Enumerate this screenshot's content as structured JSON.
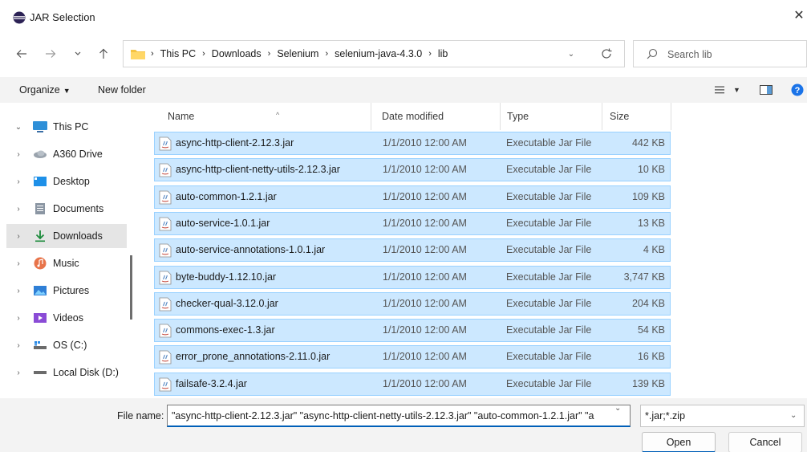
{
  "window": {
    "title": "JAR Selection",
    "close_glyph": "✕"
  },
  "address_bar": {
    "segments": [
      "This PC",
      "Downloads",
      "Selenium",
      "selenium-java-4.3.0",
      "lib"
    ],
    "separator": "›"
  },
  "search": {
    "placeholder": "Search lib"
  },
  "command_bar": {
    "organize": "Organize",
    "new_folder": "New folder"
  },
  "sidebar": {
    "items": [
      {
        "label": "This PC",
        "expanded": true,
        "icon": "pc-icon"
      },
      {
        "label": "A360 Drive",
        "icon": "cloud-drive-icon"
      },
      {
        "label": "Desktop",
        "icon": "desktop-icon"
      },
      {
        "label": "Documents",
        "icon": "documents-icon"
      },
      {
        "label": "Downloads",
        "icon": "downloads-icon",
        "selected": true
      },
      {
        "label": "Music",
        "icon": "music-icon"
      },
      {
        "label": "Pictures",
        "icon": "pictures-icon"
      },
      {
        "label": "Videos",
        "icon": "videos-icon"
      },
      {
        "label": "OS (C:)",
        "icon": "drive-c-icon"
      },
      {
        "label": "Local Disk (D:)",
        "icon": "drive-d-icon"
      }
    ]
  },
  "columns": {
    "name": "Name",
    "date": "Date modified",
    "type": "Type",
    "size": "Size"
  },
  "files": [
    {
      "name": "async-http-client-2.12.3.jar",
      "date": "1/1/2010 12:00 AM",
      "type": "Executable Jar File",
      "size": "442 KB"
    },
    {
      "name": "async-http-client-netty-utils-2.12.3.jar",
      "date": "1/1/2010 12:00 AM",
      "type": "Executable Jar File",
      "size": "10 KB"
    },
    {
      "name": "auto-common-1.2.1.jar",
      "date": "1/1/2010 12:00 AM",
      "type": "Executable Jar File",
      "size": "109 KB"
    },
    {
      "name": "auto-service-1.0.1.jar",
      "date": "1/1/2010 12:00 AM",
      "type": "Executable Jar File",
      "size": "13 KB"
    },
    {
      "name": "auto-service-annotations-1.0.1.jar",
      "date": "1/1/2010 12:00 AM",
      "type": "Executable Jar File",
      "size": "4 KB"
    },
    {
      "name": "byte-buddy-1.12.10.jar",
      "date": "1/1/2010 12:00 AM",
      "type": "Executable Jar File",
      "size": "3,747 KB"
    },
    {
      "name": "checker-qual-3.12.0.jar",
      "date": "1/1/2010 12:00 AM",
      "type": "Executable Jar File",
      "size": "204 KB"
    },
    {
      "name": "commons-exec-1.3.jar",
      "date": "1/1/2010 12:00 AM",
      "type": "Executable Jar File",
      "size": "54 KB"
    },
    {
      "name": "error_prone_annotations-2.11.0.jar",
      "date": "1/1/2010 12:00 AM",
      "type": "Executable Jar File",
      "size": "16 KB"
    },
    {
      "name": "failsafe-3.2.4.jar",
      "date": "1/1/2010 12:00 AM",
      "type": "Executable Jar File",
      "size": "139 KB"
    }
  ],
  "footer": {
    "file_name_label": "File name:",
    "file_name_value": "\"async-http-client-2.12.3.jar\" \"async-http-client-netty-utils-2.12.3.jar\" \"auto-common-1.2.1.jar\" \"a",
    "filter_value": "*.jar;*.zip",
    "open_label": "Open",
    "cancel_label": "Cancel"
  },
  "colors": {
    "selection_fill": "#cce8ff",
    "selection_border": "#99d1ff",
    "accent": "#005fb8"
  }
}
